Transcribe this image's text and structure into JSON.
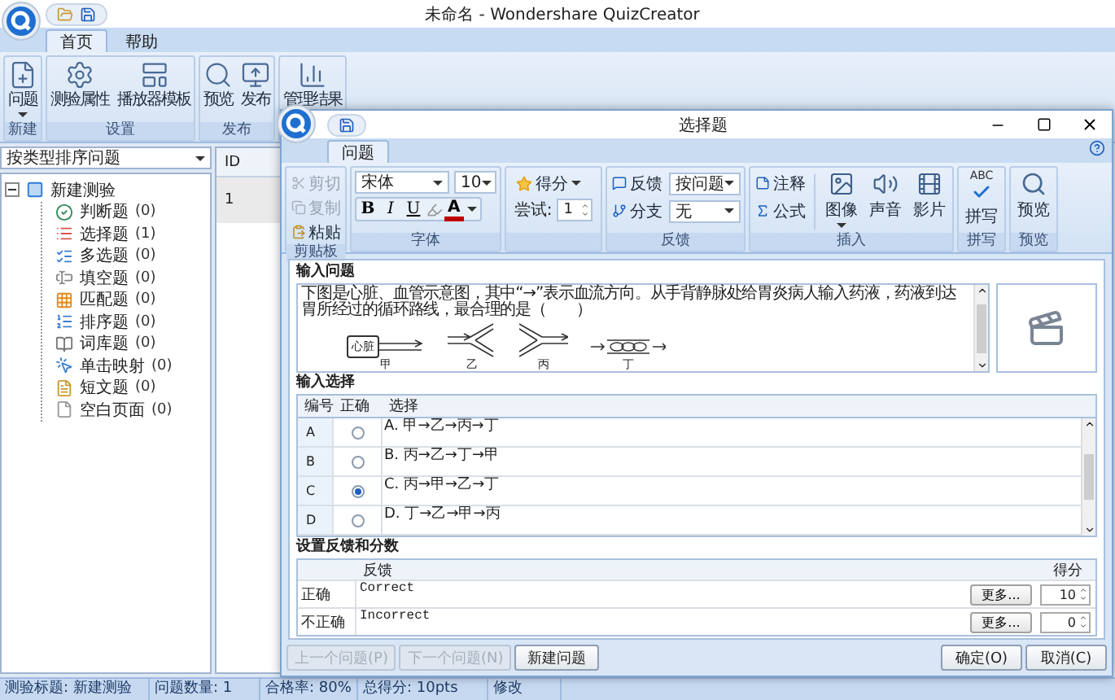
{
  "window": {
    "title": "未命名 - Wondershare QuizCreator"
  },
  "ribbon_tabs": [
    {
      "label": "首页",
      "selected": true
    },
    {
      "label": "帮助",
      "selected": false
    }
  ],
  "ribbon_groups": [
    {
      "label": "新建",
      "buttons": [
        {
          "label": "问题",
          "dropdown": true
        }
      ]
    },
    {
      "label": "设置",
      "buttons": [
        {
          "label": "测验属性",
          "dropdown": false
        },
        {
          "label": "播放器模板",
          "dropdown": false
        }
      ]
    },
    {
      "label": "发布",
      "buttons": [
        {
          "label": "预览",
          "dropdown": false
        },
        {
          "label": "发布",
          "dropdown": false
        }
      ]
    },
    {
      "buttons": [
        {
          "label": "管理结果",
          "dropdown": false
        }
      ]
    }
  ],
  "sort_dropdown": {
    "value": "按类型排序问题"
  },
  "tree": {
    "label": "新建测验",
    "expanded": true,
    "children": [
      {
        "label": "判断题",
        "count": "(0)"
      },
      {
        "label": "选择题",
        "count": "(1)"
      },
      {
        "label": "多选题",
        "count": "(0)"
      },
      {
        "label": "填空题",
        "count": "(0)"
      },
      {
        "label": "匹配题",
        "count": "(0)"
      },
      {
        "label": "排序题",
        "count": "(0)"
      },
      {
        "label": "词库题",
        "count": "(0)"
      },
      {
        "label": "单击映射",
        "count": "(0)"
      },
      {
        "label": "短文题",
        "count": "(0)"
      },
      {
        "label": "空白页面",
        "count": "(0)"
      }
    ]
  },
  "question_list": {
    "columns": [
      "ID"
    ],
    "rows": [
      "1"
    ]
  },
  "dialog": {
    "title": "选择题",
    "tabs": [
      {
        "label": "问题",
        "selected": true
      }
    ],
    "clipboard": {
      "label": "剪贴板",
      "items": [
        {
          "label": "剪切",
          "disabled": true
        },
        {
          "label": "复制",
          "disabled": true
        },
        {
          "label": "粘贴",
          "disabled": false
        }
      ]
    },
    "font": {
      "label": "字体",
      "family": "宋体",
      "size": "10",
      "styles": [
        "B",
        "I",
        "U"
      ],
      "color_button": "A"
    },
    "score": {
      "button": "得分",
      "attempts_label": "尝试:",
      "attempts": "1"
    },
    "feedback": {
      "label": "反馈",
      "rows": [
        {
          "label": "反馈",
          "value": "按问题"
        },
        {
          "label": "分支",
          "value": "无"
        }
      ]
    },
    "insert": {
      "label": "插入",
      "small": [
        {
          "label": "注释"
        },
        {
          "label": "公式"
        }
      ],
      "large": [
        {
          "label": "图像",
          "dropdown": true
        },
        {
          "label": "声音",
          "dropdown": false
        },
        {
          "label": "影片",
          "dropdown": false
        }
      ]
    },
    "spelling": {
      "label": "拼写",
      "button": "拼写",
      "icon_text": "ABC"
    },
    "preview": {
      "label": "预览",
      "button": "预览"
    },
    "question": {
      "heading": "输入问题",
      "text": "下图是心脏、血管示意图，其中“→”表示血流方向。从手背静脉处给胃炎病人输入药液，药液到达胃所经过的循环路线，最合理的是（　　）",
      "diagram": [
        {
          "kind": "heart",
          "node": "心脏",
          "label": "甲"
        },
        {
          "kind": "branch",
          "label": "乙"
        },
        {
          "kind": "merge",
          "label": "丙"
        },
        {
          "kind": "capillary",
          "label": "丁"
        }
      ]
    },
    "choices": {
      "heading": "输入选择",
      "columns": [
        "编号",
        "正确",
        "选择"
      ],
      "rows": [
        {
          "id": "A",
          "selected": false,
          "text": "A. 甲→乙→丙→丁"
        },
        {
          "id": "B",
          "selected": false,
          "text": "B. 丙→乙→丁→甲"
        },
        {
          "id": "C",
          "selected": true,
          "text": "C. 丙→甲→乙→丁"
        },
        {
          "id": "D",
          "selected": false,
          "text": "D. 丁→乙→甲→丙"
        }
      ]
    },
    "feedback_scores": {
      "heading": "设置反馈和分数",
      "columns": [
        "反馈",
        "得分"
      ],
      "rows": [
        {
          "label": "正确",
          "text": "Correct",
          "more": "更多...",
          "score": "10"
        },
        {
          "label": "不正确",
          "text": "Incorrect",
          "more": "更多...",
          "score": "0"
        }
      ]
    },
    "buttons": [
      {
        "label": "上一个问题(P)",
        "disabled": true
      },
      {
        "label": "下一个问题(N)",
        "disabled": true
      },
      {
        "label": "新建问题",
        "disabled": false
      }
    ],
    "confirm_buttons": [
      {
        "label": "确定(O)"
      },
      {
        "label": "取消(C)"
      }
    ]
  },
  "status_bar": [
    "测验标题: 新建测验",
    "问题数量: 1",
    "合格率: 80%",
    "总得分: 10pts",
    "修改"
  ]
}
